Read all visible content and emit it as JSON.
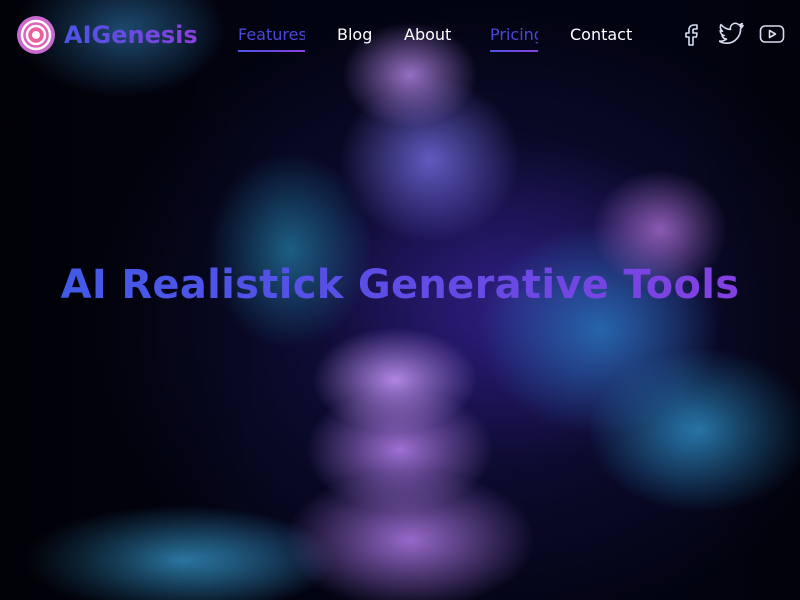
{
  "brand": {
    "name": "AIGenesis",
    "logo_icon": "target-icon"
  },
  "nav": {
    "items": [
      {
        "label": "Features",
        "active": true
      },
      {
        "label": "Blog",
        "active": false
      },
      {
        "label": "About",
        "active": false
      },
      {
        "label": "Pricing",
        "active": true
      },
      {
        "label": "Contact",
        "active": false
      }
    ]
  },
  "social": {
    "icons": [
      "facebook-icon",
      "twitter-icon",
      "youtube-icon"
    ]
  },
  "hero": {
    "title": "AI Realistick Generative Tools"
  },
  "colors": {
    "accent_start": "#3d5ce8",
    "accent_end": "#8a3ee0",
    "nav_text": "#ffffff",
    "logo_mark": "#ff5a8a"
  }
}
